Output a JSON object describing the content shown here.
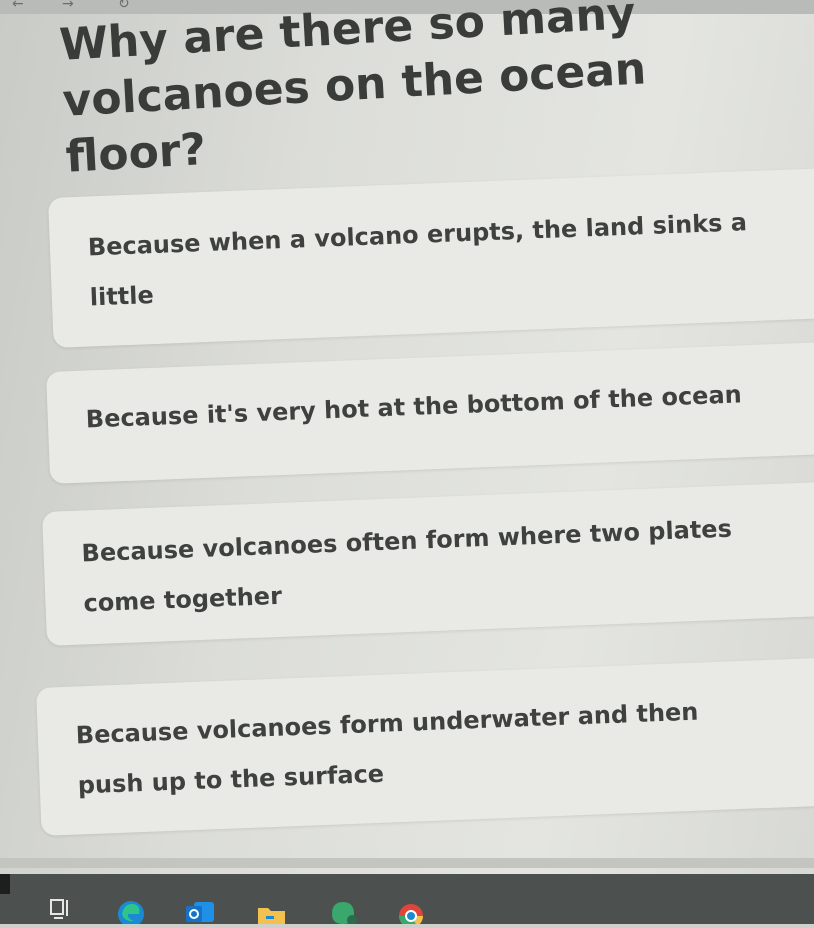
{
  "question": {
    "line1": "Why are there so many",
    "line2": "volcanoes on the ocean floor?"
  },
  "answers": [
    {
      "line1": "Because when a volcano erupts, the land sinks a",
      "line2": "little"
    },
    {
      "line1": "Because it's very hot at the bottom of the ocean",
      "line2": ""
    },
    {
      "line1": "Because volcanoes often form where two plates",
      "line2": "come together"
    },
    {
      "line1": "Because volcanoes form underwater and then",
      "line2": "push up to the surface"
    }
  ],
  "browser": {
    "back_icon": "arrow-left",
    "forward_icon": "arrow-right",
    "reload_icon": "reload"
  },
  "taskbar": {
    "icons": [
      "task-view",
      "edge",
      "outlook",
      "file-explorer",
      "teams-chat",
      "chrome"
    ],
    "colors": {
      "background": "#4c504f",
      "edge_blue": "#1a8ad4",
      "outlook_blue": "#1473c9",
      "explorer_yellow": "#f2c14e",
      "chat_green": "#3aa76d",
      "chrome_red": "#e0453a"
    }
  }
}
